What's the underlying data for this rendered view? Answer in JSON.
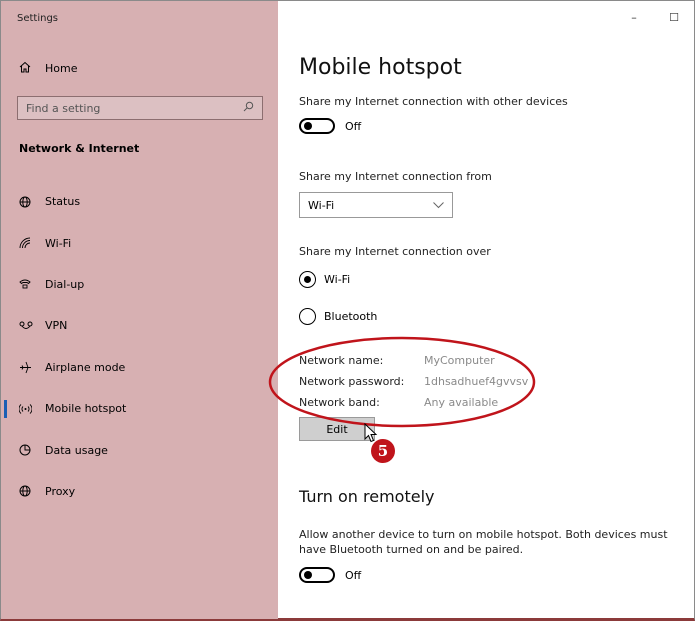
{
  "window": {
    "title": "Settings",
    "minimize_glyph": "–",
    "maximize_glyph": "☐"
  },
  "sidebar": {
    "home_label": "Home",
    "search_placeholder": "Find a setting",
    "section_title": "Network & Internet",
    "items": [
      {
        "label": "Status",
        "icon": "globe-icon"
      },
      {
        "label": "Wi-Fi",
        "icon": "wifi-icon"
      },
      {
        "label": "Dial-up",
        "icon": "phone-icon"
      },
      {
        "label": "VPN",
        "icon": "vpn-icon"
      },
      {
        "label": "Airplane mode",
        "icon": "airplane-icon"
      },
      {
        "label": "Mobile hotspot",
        "icon": "hotspot-icon",
        "active": true
      },
      {
        "label": "Data usage",
        "icon": "data-usage-icon"
      },
      {
        "label": "Proxy",
        "icon": "proxy-globe-icon"
      }
    ]
  },
  "main": {
    "title": "Mobile hotspot",
    "share_label": "Share my Internet connection with other devices",
    "share_toggle_state": "Off",
    "from_label": "Share my Internet connection from",
    "from_value": "Wi-Fi",
    "over_label": "Share my Internet connection over",
    "over_options": [
      {
        "label": "Wi-Fi",
        "checked": true
      },
      {
        "label": "Bluetooth",
        "checked": false
      }
    ],
    "network": {
      "name_key": "Network name:",
      "name_value": "MyComputer",
      "password_key": "Network password:",
      "password_value": "1dhsadhuef4gvvsv",
      "band_key": "Network band:",
      "band_value": "Any available"
    },
    "edit_label": "Edit",
    "remote_title": "Turn on remotely",
    "remote_desc": "Allow another device to turn on mobile hotspot. Both devices must have Bluetooth turned on and be paired.",
    "remote_toggle_state": "Off"
  },
  "annotation": {
    "step_number": "5",
    "color": "#c0141b"
  }
}
